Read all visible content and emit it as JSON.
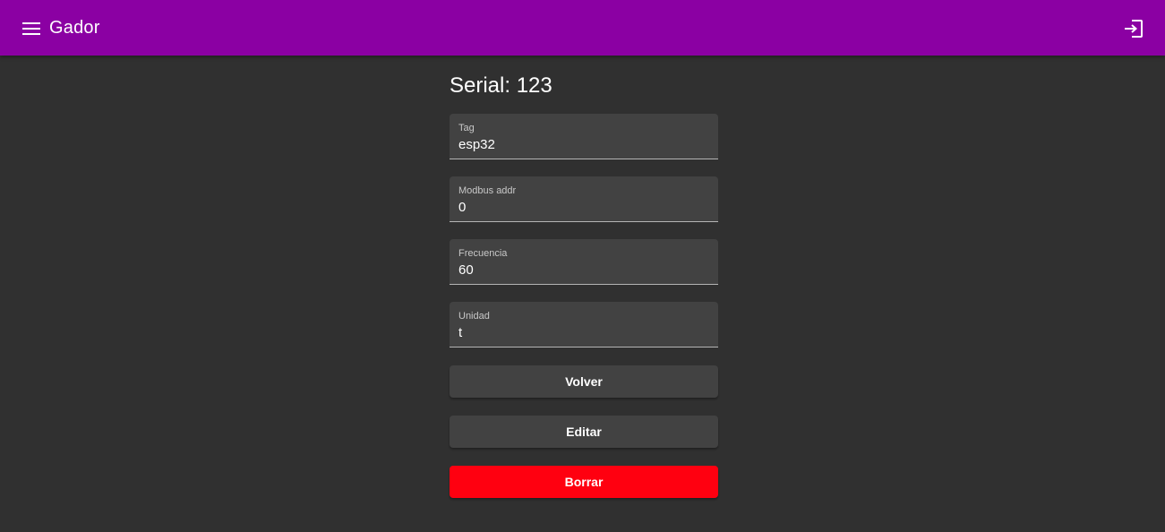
{
  "appbar": {
    "title": "Gador",
    "menu_icon": "menu-icon",
    "login_icon": "login-icon",
    "color": "#8b00a3"
  },
  "page": {
    "serial_label": "Serial: 123"
  },
  "form": {
    "fields": [
      {
        "label": "Tag",
        "value": "esp32"
      },
      {
        "label": "Modbus addr",
        "value": "0"
      },
      {
        "label": "Frecuencia",
        "value": "60"
      },
      {
        "label": "Unidad",
        "value": "t"
      }
    ]
  },
  "actions": {
    "back_label": "Volver",
    "edit_label": "Editar",
    "delete_label": "Borrar",
    "delete_color": "#ff0010"
  }
}
